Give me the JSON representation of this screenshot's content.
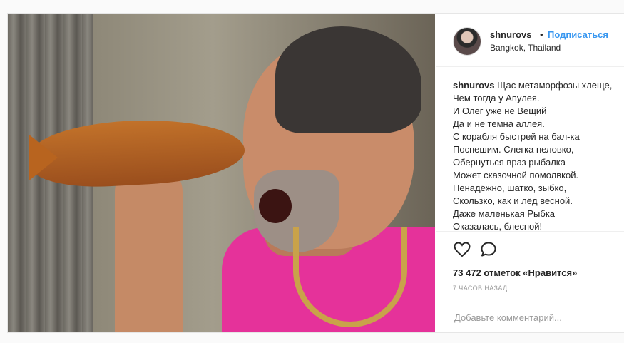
{
  "post": {
    "username": "shnurovs",
    "separator": "•",
    "follow_label": "Подписаться",
    "location": "Bangkok, Thailand"
  },
  "caption": {
    "username": "shnurovs",
    "first_line": "Щас метаморфозы хлеще,",
    "lines": [
      "Чем тогда у Апулея.",
      "И Олег уже не Вещий",
      "Да и не темна аллея.",
      "С корабля быстрей на бал-ка",
      "Поспешим. Слегка неловко,",
      "Обернуться враз рыбалка",
      "Может сказочной помолвкой.",
      "Ненадёжно, шатко, зыбко,",
      "Скользко, как и лёд весной.",
      "Даже маленькая Рыбка",
      "Оказалась, блесной!"
    ]
  },
  "stats": {
    "likes": "73 472 отметок «Нравится»",
    "time": "7 ЧАСОВ НАЗАД"
  },
  "comment": {
    "placeholder": "Добавьте комментарий..."
  },
  "icons": {
    "like": "heart-icon",
    "comment": "speech-bubble-icon"
  },
  "colors": {
    "link": "#3897f0",
    "text": "#262626",
    "muted": "#999999",
    "border": "#efefef"
  }
}
